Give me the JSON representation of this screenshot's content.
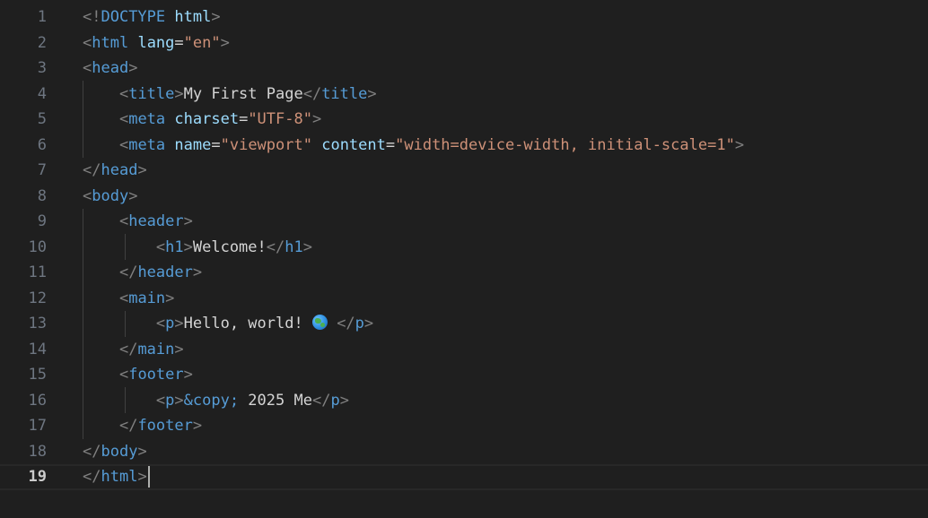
{
  "editor": {
    "language": "html",
    "active_line": 19,
    "colors": {
      "background": "#1f1f1f",
      "line_number": "#6e7681",
      "line_number_active": "#cccccc",
      "bracket": "#808080",
      "tag": "#569cd6",
      "attribute": "#9cdcfe",
      "string": "#ce9178",
      "text": "#d4d4d4"
    },
    "lines": [
      {
        "num": "1",
        "tokens": [
          [
            "br",
            "<!"
          ],
          [
            "tag",
            "DOCTYPE"
          ],
          [
            "txt",
            " "
          ],
          [
            "attr",
            "html"
          ],
          [
            "br",
            ">"
          ]
        ]
      },
      {
        "num": "2",
        "tokens": [
          [
            "br",
            "<"
          ],
          [
            "tag",
            "html"
          ],
          [
            "txt",
            " "
          ],
          [
            "attr",
            "lang"
          ],
          [
            "txt",
            "="
          ],
          [
            "str",
            "\"en\""
          ],
          [
            "br",
            ">"
          ]
        ]
      },
      {
        "num": "3",
        "tokens": [
          [
            "br",
            "<"
          ],
          [
            "tag",
            "head"
          ],
          [
            "br",
            ">"
          ]
        ]
      },
      {
        "num": "4",
        "tokens": [
          [
            "txt",
            "    "
          ],
          [
            "br",
            "<"
          ],
          [
            "tag",
            "title"
          ],
          [
            "br",
            ">"
          ],
          [
            "txt",
            "My First Page"
          ],
          [
            "br",
            "</"
          ],
          [
            "tag",
            "title"
          ],
          [
            "br",
            ">"
          ]
        ]
      },
      {
        "num": "5",
        "tokens": [
          [
            "txt",
            "    "
          ],
          [
            "br",
            "<"
          ],
          [
            "tag",
            "meta"
          ],
          [
            "txt",
            " "
          ],
          [
            "attr",
            "charset"
          ],
          [
            "txt",
            "="
          ],
          [
            "str",
            "\"UTF-8\""
          ],
          [
            "br",
            ">"
          ]
        ]
      },
      {
        "num": "6",
        "tokens": [
          [
            "txt",
            "    "
          ],
          [
            "br",
            "<"
          ],
          [
            "tag",
            "meta"
          ],
          [
            "txt",
            " "
          ],
          [
            "attr",
            "name"
          ],
          [
            "txt",
            "="
          ],
          [
            "str",
            "\"viewport\""
          ],
          [
            "txt",
            " "
          ],
          [
            "attr",
            "content"
          ],
          [
            "txt",
            "="
          ],
          [
            "str",
            "\"width=device-width, initial-scale=1\""
          ],
          [
            "br",
            ">"
          ]
        ]
      },
      {
        "num": "7",
        "tokens": [
          [
            "br",
            "</"
          ],
          [
            "tag",
            "head"
          ],
          [
            "br",
            ">"
          ]
        ]
      },
      {
        "num": "8",
        "tokens": [
          [
            "br",
            "<"
          ],
          [
            "tag",
            "body"
          ],
          [
            "br",
            ">"
          ]
        ]
      },
      {
        "num": "9",
        "tokens": [
          [
            "txt",
            "    "
          ],
          [
            "br",
            "<"
          ],
          [
            "tag",
            "header"
          ],
          [
            "br",
            ">"
          ]
        ]
      },
      {
        "num": "10",
        "tokens": [
          [
            "txt",
            "        "
          ],
          [
            "br",
            "<"
          ],
          [
            "tag",
            "h1"
          ],
          [
            "br",
            ">"
          ],
          [
            "txt",
            "Welcome!"
          ],
          [
            "br",
            "</"
          ],
          [
            "tag",
            "h1"
          ],
          [
            "br",
            ">"
          ]
        ]
      },
      {
        "num": "11",
        "tokens": [
          [
            "txt",
            "    "
          ],
          [
            "br",
            "</"
          ],
          [
            "tag",
            "header"
          ],
          [
            "br",
            ">"
          ]
        ]
      },
      {
        "num": "12",
        "tokens": [
          [
            "txt",
            "    "
          ],
          [
            "br",
            "<"
          ],
          [
            "tag",
            "main"
          ],
          [
            "br",
            ">"
          ]
        ]
      },
      {
        "num": "13",
        "tokens": [
          [
            "txt",
            "        "
          ],
          [
            "br",
            "<"
          ],
          [
            "tag",
            "p"
          ],
          [
            "br",
            ">"
          ],
          [
            "txt",
            "Hello, world! "
          ],
          [
            "globe",
            "globe-emoji"
          ],
          [
            "txt",
            " "
          ],
          [
            "br",
            "</"
          ],
          [
            "tag",
            "p"
          ],
          [
            "br",
            ">"
          ]
        ]
      },
      {
        "num": "14",
        "tokens": [
          [
            "txt",
            "    "
          ],
          [
            "br",
            "</"
          ],
          [
            "tag",
            "main"
          ],
          [
            "br",
            ">"
          ]
        ]
      },
      {
        "num": "15",
        "tokens": [
          [
            "txt",
            "    "
          ],
          [
            "br",
            "<"
          ],
          [
            "tag",
            "footer"
          ],
          [
            "br",
            ">"
          ]
        ]
      },
      {
        "num": "16",
        "tokens": [
          [
            "txt",
            "        "
          ],
          [
            "br",
            "<"
          ],
          [
            "tag",
            "p"
          ],
          [
            "br",
            ">"
          ],
          [
            "ent",
            "&copy;"
          ],
          [
            "txt",
            " 2025 Me"
          ],
          [
            "br",
            "</"
          ],
          [
            "tag",
            "p"
          ],
          [
            "br",
            ">"
          ]
        ]
      },
      {
        "num": "17",
        "tokens": [
          [
            "txt",
            "    "
          ],
          [
            "br",
            "</"
          ],
          [
            "tag",
            "footer"
          ],
          [
            "br",
            ">"
          ]
        ]
      },
      {
        "num": "18",
        "tokens": [
          [
            "br",
            "</"
          ],
          [
            "tag",
            "body"
          ],
          [
            "br",
            ">"
          ]
        ]
      },
      {
        "num": "19",
        "tokens": [
          [
            "br",
            "</"
          ],
          [
            "tag",
            "html"
          ],
          [
            "br",
            ">"
          ],
          [
            "cursor",
            "text-cursor"
          ]
        ]
      }
    ]
  }
}
